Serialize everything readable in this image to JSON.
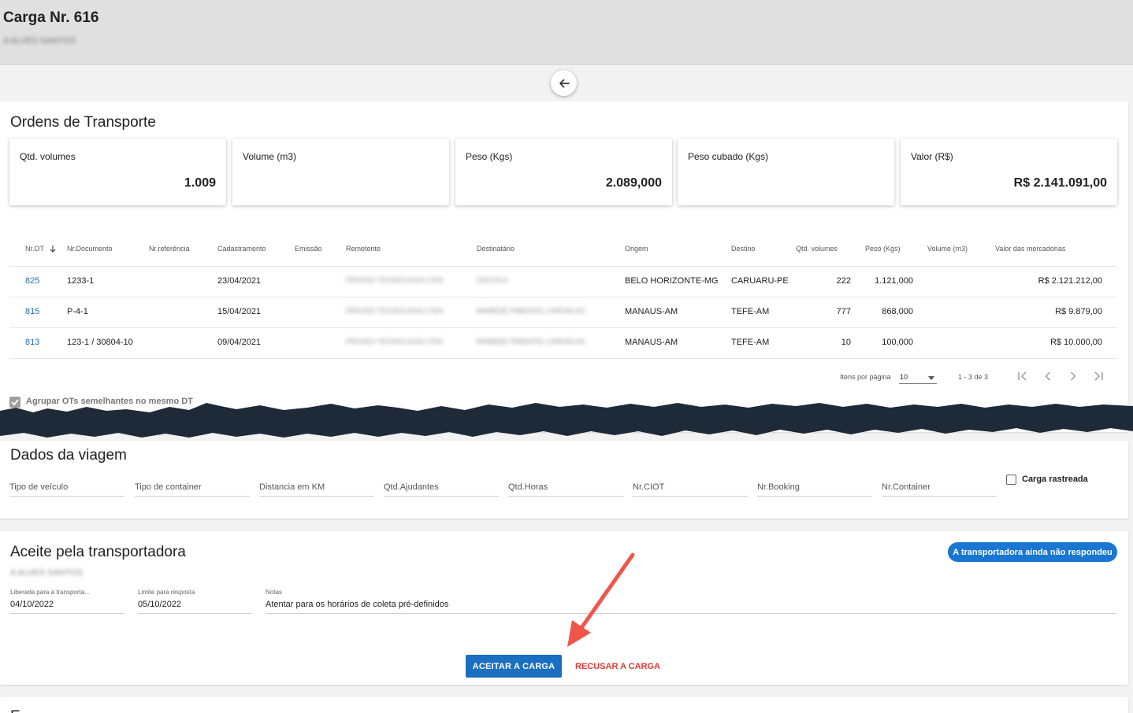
{
  "header": {
    "title": "Carga Nr. 616",
    "subtitle": "A ALVES SANTOS"
  },
  "icons": {
    "back": "arrow-left-icon",
    "sort": "arrow-down-icon"
  },
  "ordens": {
    "title": "Ordens de Transporte",
    "stats": [
      {
        "label": "Qtd. volumes",
        "value": "1.009"
      },
      {
        "label": "Volume (m3)",
        "value": ""
      },
      {
        "label": "Peso (Kgs)",
        "value": "2.089,000"
      },
      {
        "label": "Peso cubado (Kgs)",
        "value": ""
      },
      {
        "label": "Valor (R$)",
        "value": "R$ 2.141.091,00"
      }
    ],
    "columns": [
      "Nr.OT",
      "Nr.Documento",
      "Nr.referência",
      "Cadastramento",
      "Emissão",
      "Remetente",
      "Destinatário",
      "Origem",
      "Destino",
      "Qtd. volumes",
      "Peso (Kgs)",
      "Volume (m3)",
      "Valor das mercadorias"
    ],
    "rows": [
      {
        "ot": "825",
        "documento": "1233-1",
        "referencia": "",
        "cadastramento": "23/04/2021",
        "emissao": "",
        "remetente": "PROVEX TECNOLOGIA LTDA",
        "destinatario": "GESTICA",
        "origem": "BELO HORIZONTE-MG",
        "destino": "CARUARU-PE",
        "volumes": "222",
        "peso": "1.121,000",
        "volume_m3": "",
        "valor": "R$ 2.121.212,00"
      },
      {
        "ot": "815",
        "documento": "P-4-1",
        "referencia": "",
        "cadastramento": "15/04/2021",
        "emissao": "",
        "remetente": "PROVEX TECNOLOGIA LTDA",
        "destinatario": "MAMEDE PIMENTEL CARVALHO",
        "origem": "MANAUS-AM",
        "destino": "TEFE-AM",
        "volumes": "777",
        "peso": "868,000",
        "volume_m3": "",
        "valor": "R$ 9.879,00"
      },
      {
        "ot": "813",
        "documento": "123-1 / 30804-10",
        "referencia": "",
        "cadastramento": "09/04/2021",
        "emissao": "",
        "remetente": "PROVEX TECNOLOGIA LTDA",
        "destinatario": "MAMEDE PIMENTEL CARVALHO",
        "origem": "MANAUS-AM",
        "destino": "TEFE-AM",
        "volumes": "10",
        "peso": "100,000",
        "volume_m3": "",
        "valor": "R$ 10.000,00"
      }
    ],
    "paginator": {
      "items_label": "Itens por página",
      "page_size": "10",
      "range": "1 - 3 de 3"
    },
    "group_checkbox_label": "Agrupar OTs semelhantes no mesmo DT"
  },
  "viagem": {
    "title": "Dados da viagem",
    "fields": [
      "Tipo de veículo",
      "Tipo de container",
      "Distancia em KM",
      "Qtd.Ajudantes",
      "Qtd.Horas",
      "Nr.CIOT",
      "Nr.Booking",
      "Nr.Container"
    ],
    "tracked_label": "Carga rastreada"
  },
  "aceite": {
    "title": "Aceite pela transportadora",
    "carrier_name": "A ALVES SANTOS",
    "status": "A transportadora ainda não respondeu",
    "released_label": "Liberada para a transporta...",
    "released_value": "04/10/2022",
    "limit_label": "Limite para resposta",
    "limit_value": "05/10/2022",
    "notes_label": "Notas",
    "notes_value": "Atentar para os horários de coleta pré-definidos",
    "accept_label": "ACEITAR A CARGA",
    "refuse_label": "RECUSAR A CARGA"
  },
  "bottom": {
    "title_partial": "E"
  },
  "colors": {
    "primary": "#1976d2",
    "refuse": "#e53935",
    "annotation_arrow": "#f0554a",
    "link": "#1e6fb8"
  }
}
